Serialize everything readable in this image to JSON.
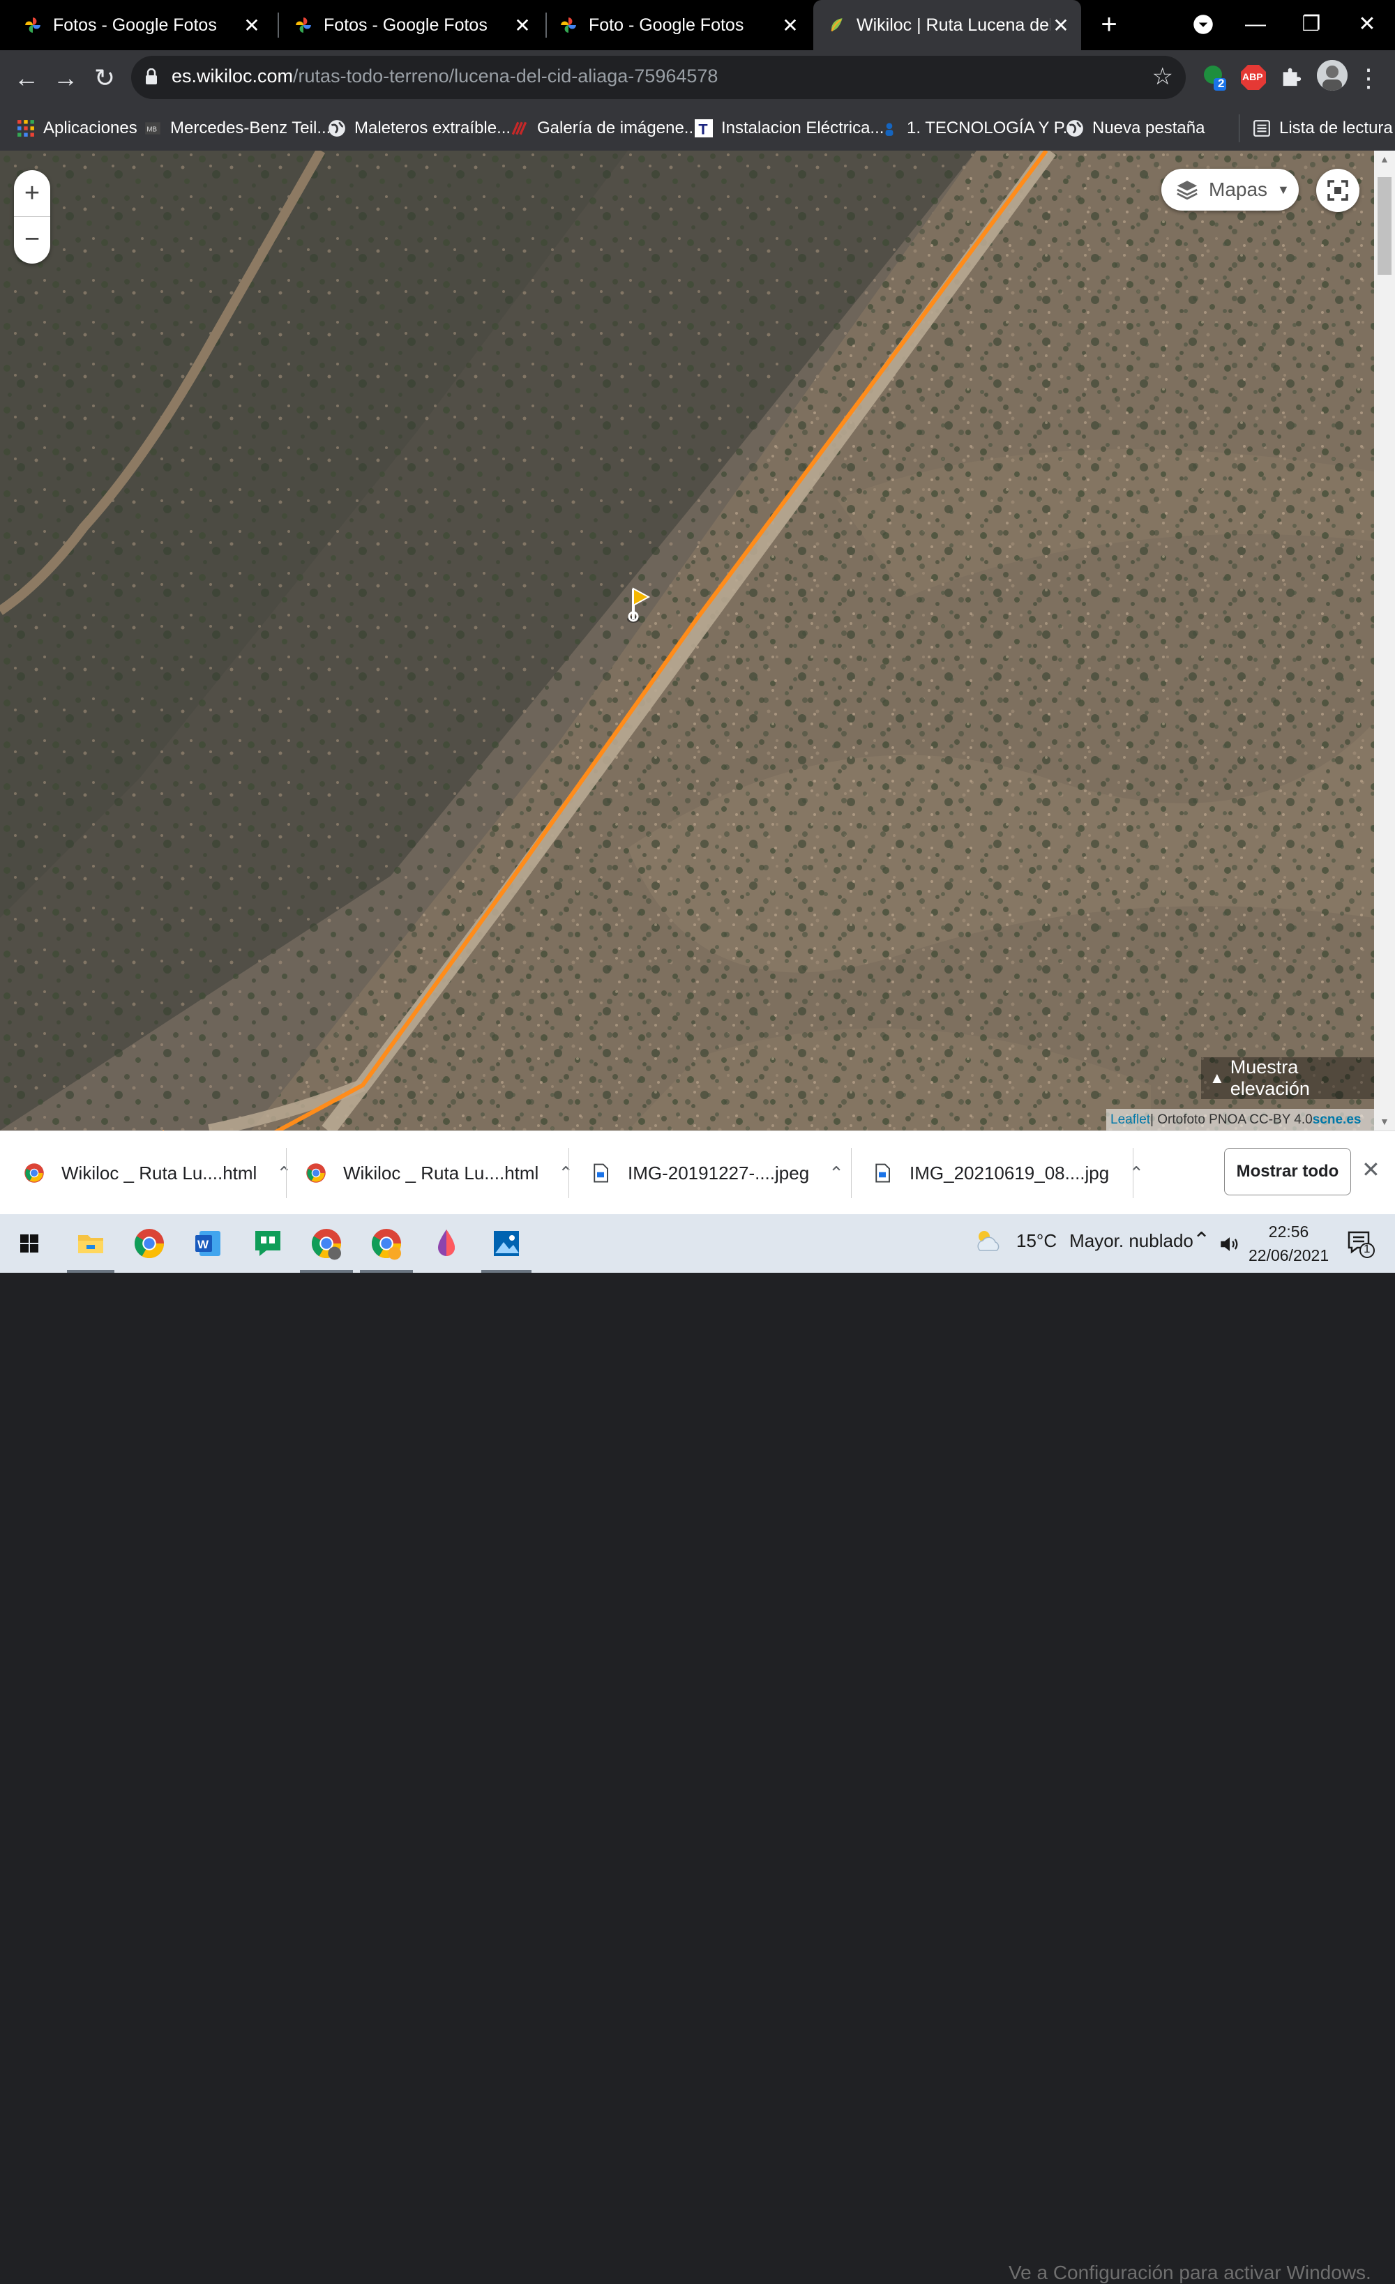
{
  "tabs": [
    {
      "title": "Fotos - Google Fotos",
      "close": "✕"
    },
    {
      "title": "Fotos - Google Fotos",
      "close": "✕"
    },
    {
      "title": "Foto - Google Fotos",
      "close": "✕"
    },
    {
      "title": "Wikiloc | Ruta Lucena del Cid",
      "close": "✕",
      "active": true
    }
  ],
  "new_tab_label": "+",
  "window_controls": {
    "minimize": "—",
    "restore": "❐",
    "close": "✕"
  },
  "toolbar": {
    "back": "←",
    "forward": "→",
    "reload": "↻",
    "url_host": "es.wikiloc.com",
    "url_path": "/rutas-todo-terreno/lucena-del-cid-aliaga-75964578",
    "star": "☆",
    "extension_badge": "2",
    "abp_label": "ABP",
    "menu": "⋮"
  },
  "bookmarks": [
    {
      "label": "Aplicaciones",
      "icon": "apps-grid-icon"
    },
    {
      "label": "Mercedes-Benz Teil...",
      "icon": "mb-icon"
    },
    {
      "label": "Maleteros extraíble...",
      "icon": "globe-icon"
    },
    {
      "label": "Galería de imágene...",
      "icon": "gallery-icon"
    },
    {
      "label": "Instalacion Eléctrica...",
      "icon": "t-icon"
    },
    {
      "label": "1. TECNOLOGÍA Y P...",
      "icon": "person-icon"
    },
    {
      "label": "Nueva pestaña",
      "icon": "globe-icon"
    }
  ],
  "reading_list": "Lista de lectura",
  "map": {
    "zoom_in": "+",
    "zoom_out": "−",
    "layers_label": "Mapas",
    "elevation_label": "Muestra elevación",
    "attribution_leaflet": "Leaflet",
    "attribution_text": " | Ortofoto PNOA CC-BY 4.0 ",
    "attribution_link": "scne.es",
    "route_color": "#ff8c1a"
  },
  "watermark": "Ve a Configuración para activar Windows.",
  "downloads": [
    {
      "name": "Wikiloc _ Ruta Lu....html",
      "icon": "chrome-icon"
    },
    {
      "name": "Wikiloc _ Ruta Lu....html",
      "icon": "chrome-icon"
    },
    {
      "name": "IMG-20191227-....jpeg",
      "icon": "file-icon"
    },
    {
      "name": "IMG_20210619_08....jpg",
      "icon": "file-icon"
    }
  ],
  "show_all": "Mostrar todo",
  "downloads_close": "✕",
  "taskbar": {
    "temperature": "15°C",
    "weather": "Mayor. nublado",
    "time": "22:56",
    "date": "22/06/2021",
    "notification_count": "1"
  }
}
